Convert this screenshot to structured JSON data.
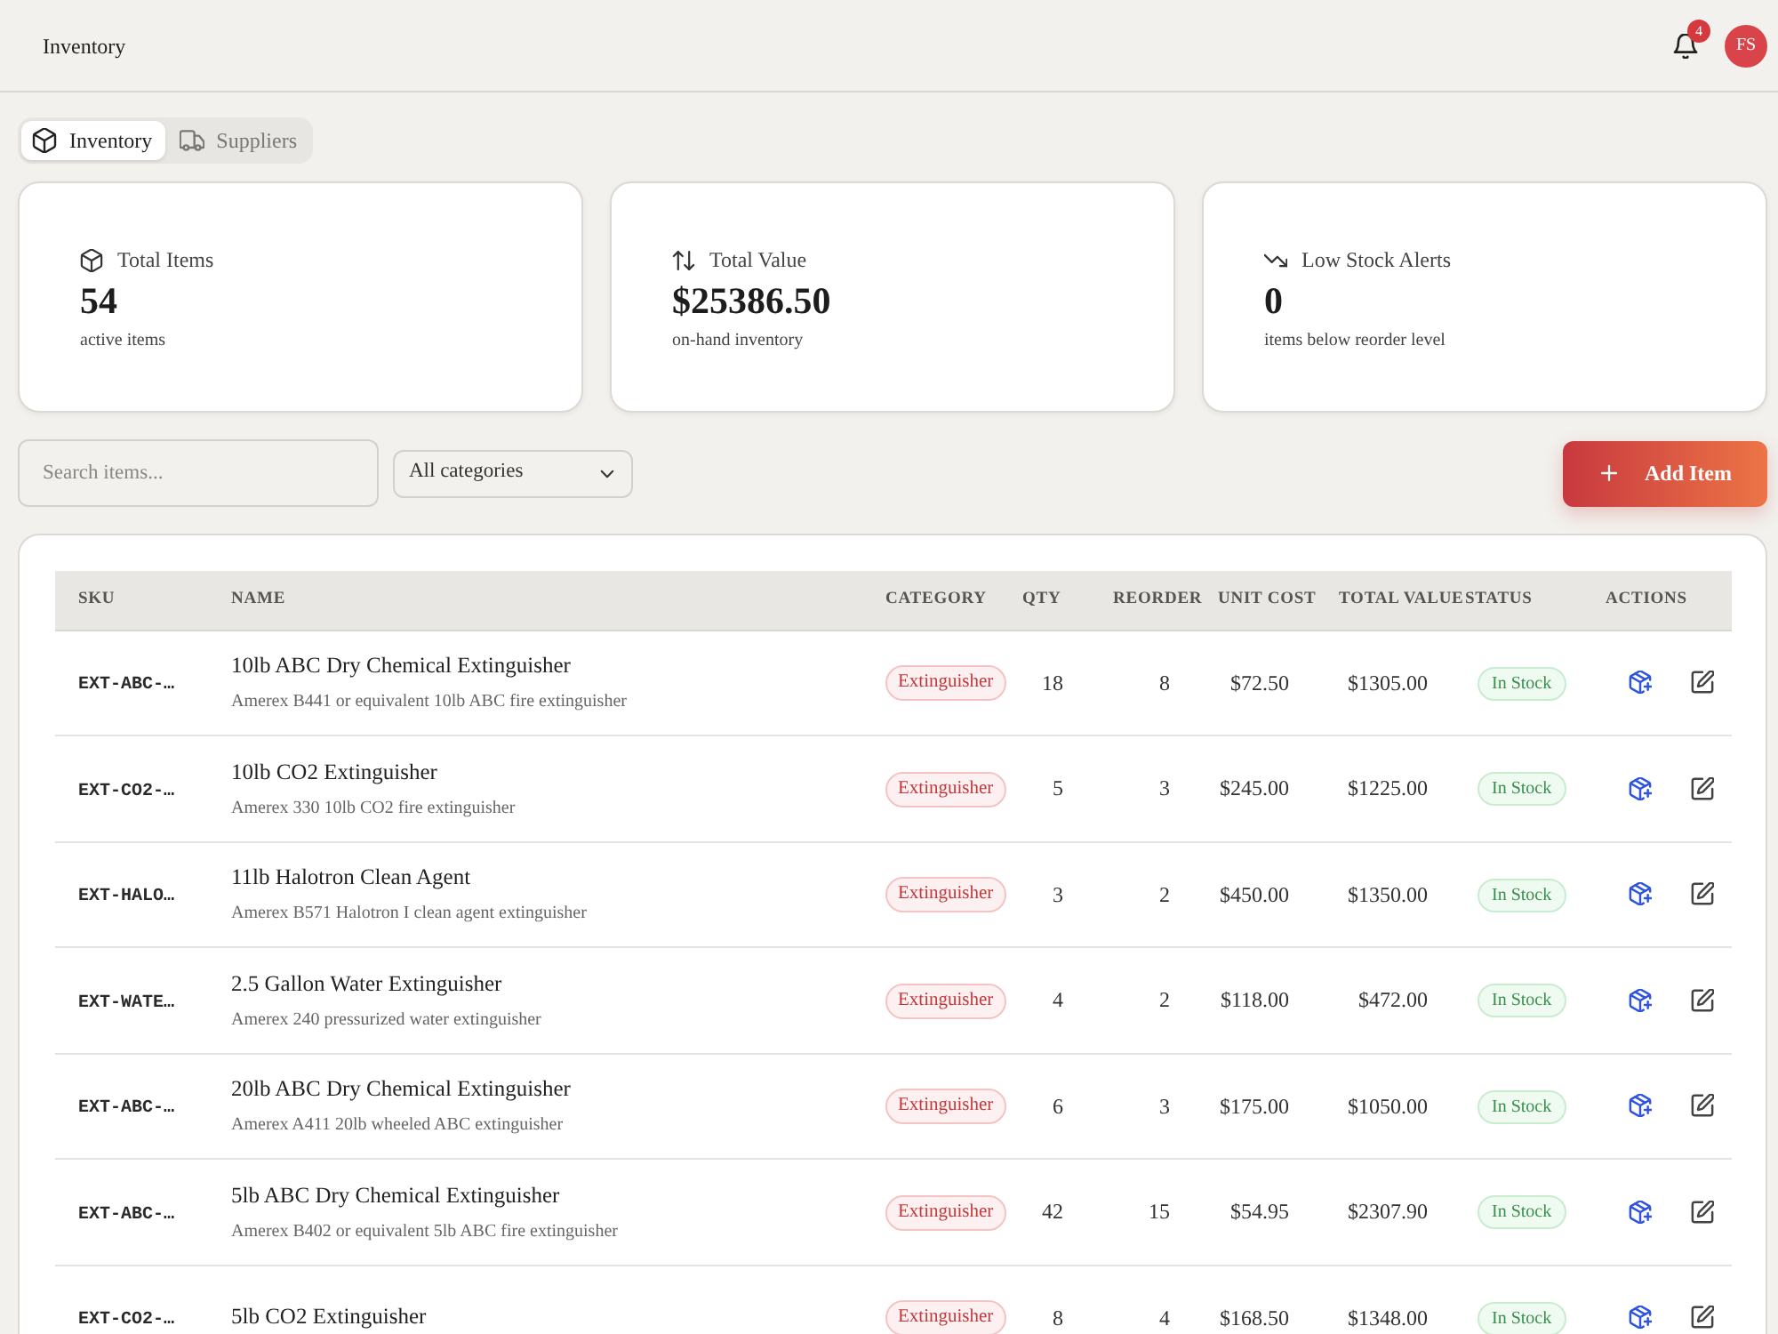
{
  "header": {
    "title": "Inventory",
    "notifications": {
      "count": "4"
    },
    "avatar": {
      "initials": "FS"
    }
  },
  "tabs": [
    {
      "label": "Inventory",
      "kind": "items",
      "selected": true
    },
    {
      "label": "Suppliers",
      "kind": "suppliers",
      "selected": false
    }
  ],
  "stats": [
    {
      "kind": "items",
      "label": "Total Items",
      "value": "54",
      "caption": "active items"
    },
    {
      "kind": "value",
      "label": "Total Value",
      "value": "$25386.50",
      "caption": "on-hand inventory"
    },
    {
      "kind": "alerts",
      "label": "Low Stock Alerts",
      "value": "0",
      "caption": "items below reorder level"
    }
  ],
  "filters": {
    "search": {
      "placeholder": "Search items..."
    },
    "category": {
      "value": "All categories"
    }
  },
  "add_button": {
    "label": "Add Item"
  },
  "table": {
    "columns": [
      "SKU",
      "NAME",
      "CATEGORY",
      "QTY",
      "REORDER",
      "UNIT COST",
      "TOTAL VALUE",
      "STATUS",
      "ACTIONS"
    ],
    "rows": [
      {
        "sku": "EXT-ABC-…",
        "name": "10lb ABC Dry Chemical Extinguisher",
        "description": "Amerex B441 or equivalent 10lb ABC fire extinguisher",
        "category": "Extinguisher",
        "qty": "18",
        "reorder": "8",
        "unit_cost": "$72.50",
        "total_value": "$1305.00",
        "status": "In Stock"
      },
      {
        "sku": "EXT-CO2-…",
        "name": "10lb CO2 Extinguisher",
        "description": "Amerex 330 10lb CO2 fire extinguisher",
        "category": "Extinguisher",
        "qty": "5",
        "reorder": "3",
        "unit_cost": "$245.00",
        "total_value": "$1225.00",
        "status": "In Stock"
      },
      {
        "sku": "EXT-HALO…",
        "name": "11lb Halotron Clean Agent",
        "description": "Amerex B571 Halotron I clean agent extinguisher",
        "category": "Extinguisher",
        "qty": "3",
        "reorder": "2",
        "unit_cost": "$450.00",
        "total_value": "$1350.00",
        "status": "In Stock"
      },
      {
        "sku": "EXT-WATE…",
        "name": "2.5 Gallon Water Extinguisher",
        "description": "Amerex 240 pressurized water extinguisher",
        "category": "Extinguisher",
        "qty": "4",
        "reorder": "2",
        "unit_cost": "$118.00",
        "total_value": "$472.00",
        "status": "In Stock"
      },
      {
        "sku": "EXT-ABC-…",
        "name": "20lb ABC Dry Chemical Extinguisher",
        "description": "Amerex A411 20lb wheeled ABC extinguisher",
        "category": "Extinguisher",
        "qty": "6",
        "reorder": "3",
        "unit_cost": "$175.00",
        "total_value": "$1050.00",
        "status": "In Stock"
      },
      {
        "sku": "EXT-ABC-…",
        "name": "5lb ABC Dry Chemical Extinguisher",
        "description": "Amerex B402 or equivalent 5lb ABC fire extinguisher",
        "category": "Extinguisher",
        "qty": "42",
        "reorder": "15",
        "unit_cost": "$54.95",
        "total_value": "$2307.90",
        "status": "In Stock"
      },
      {
        "sku": "EXT-CO2-…",
        "name": "5lb CO2 Extinguisher",
        "category": "Extinguisher",
        "qty": "8",
        "reorder": "4",
        "unit_cost": "$168.50",
        "total_value": "$1348.00",
        "status": "In Stock"
      }
    ]
  }
}
